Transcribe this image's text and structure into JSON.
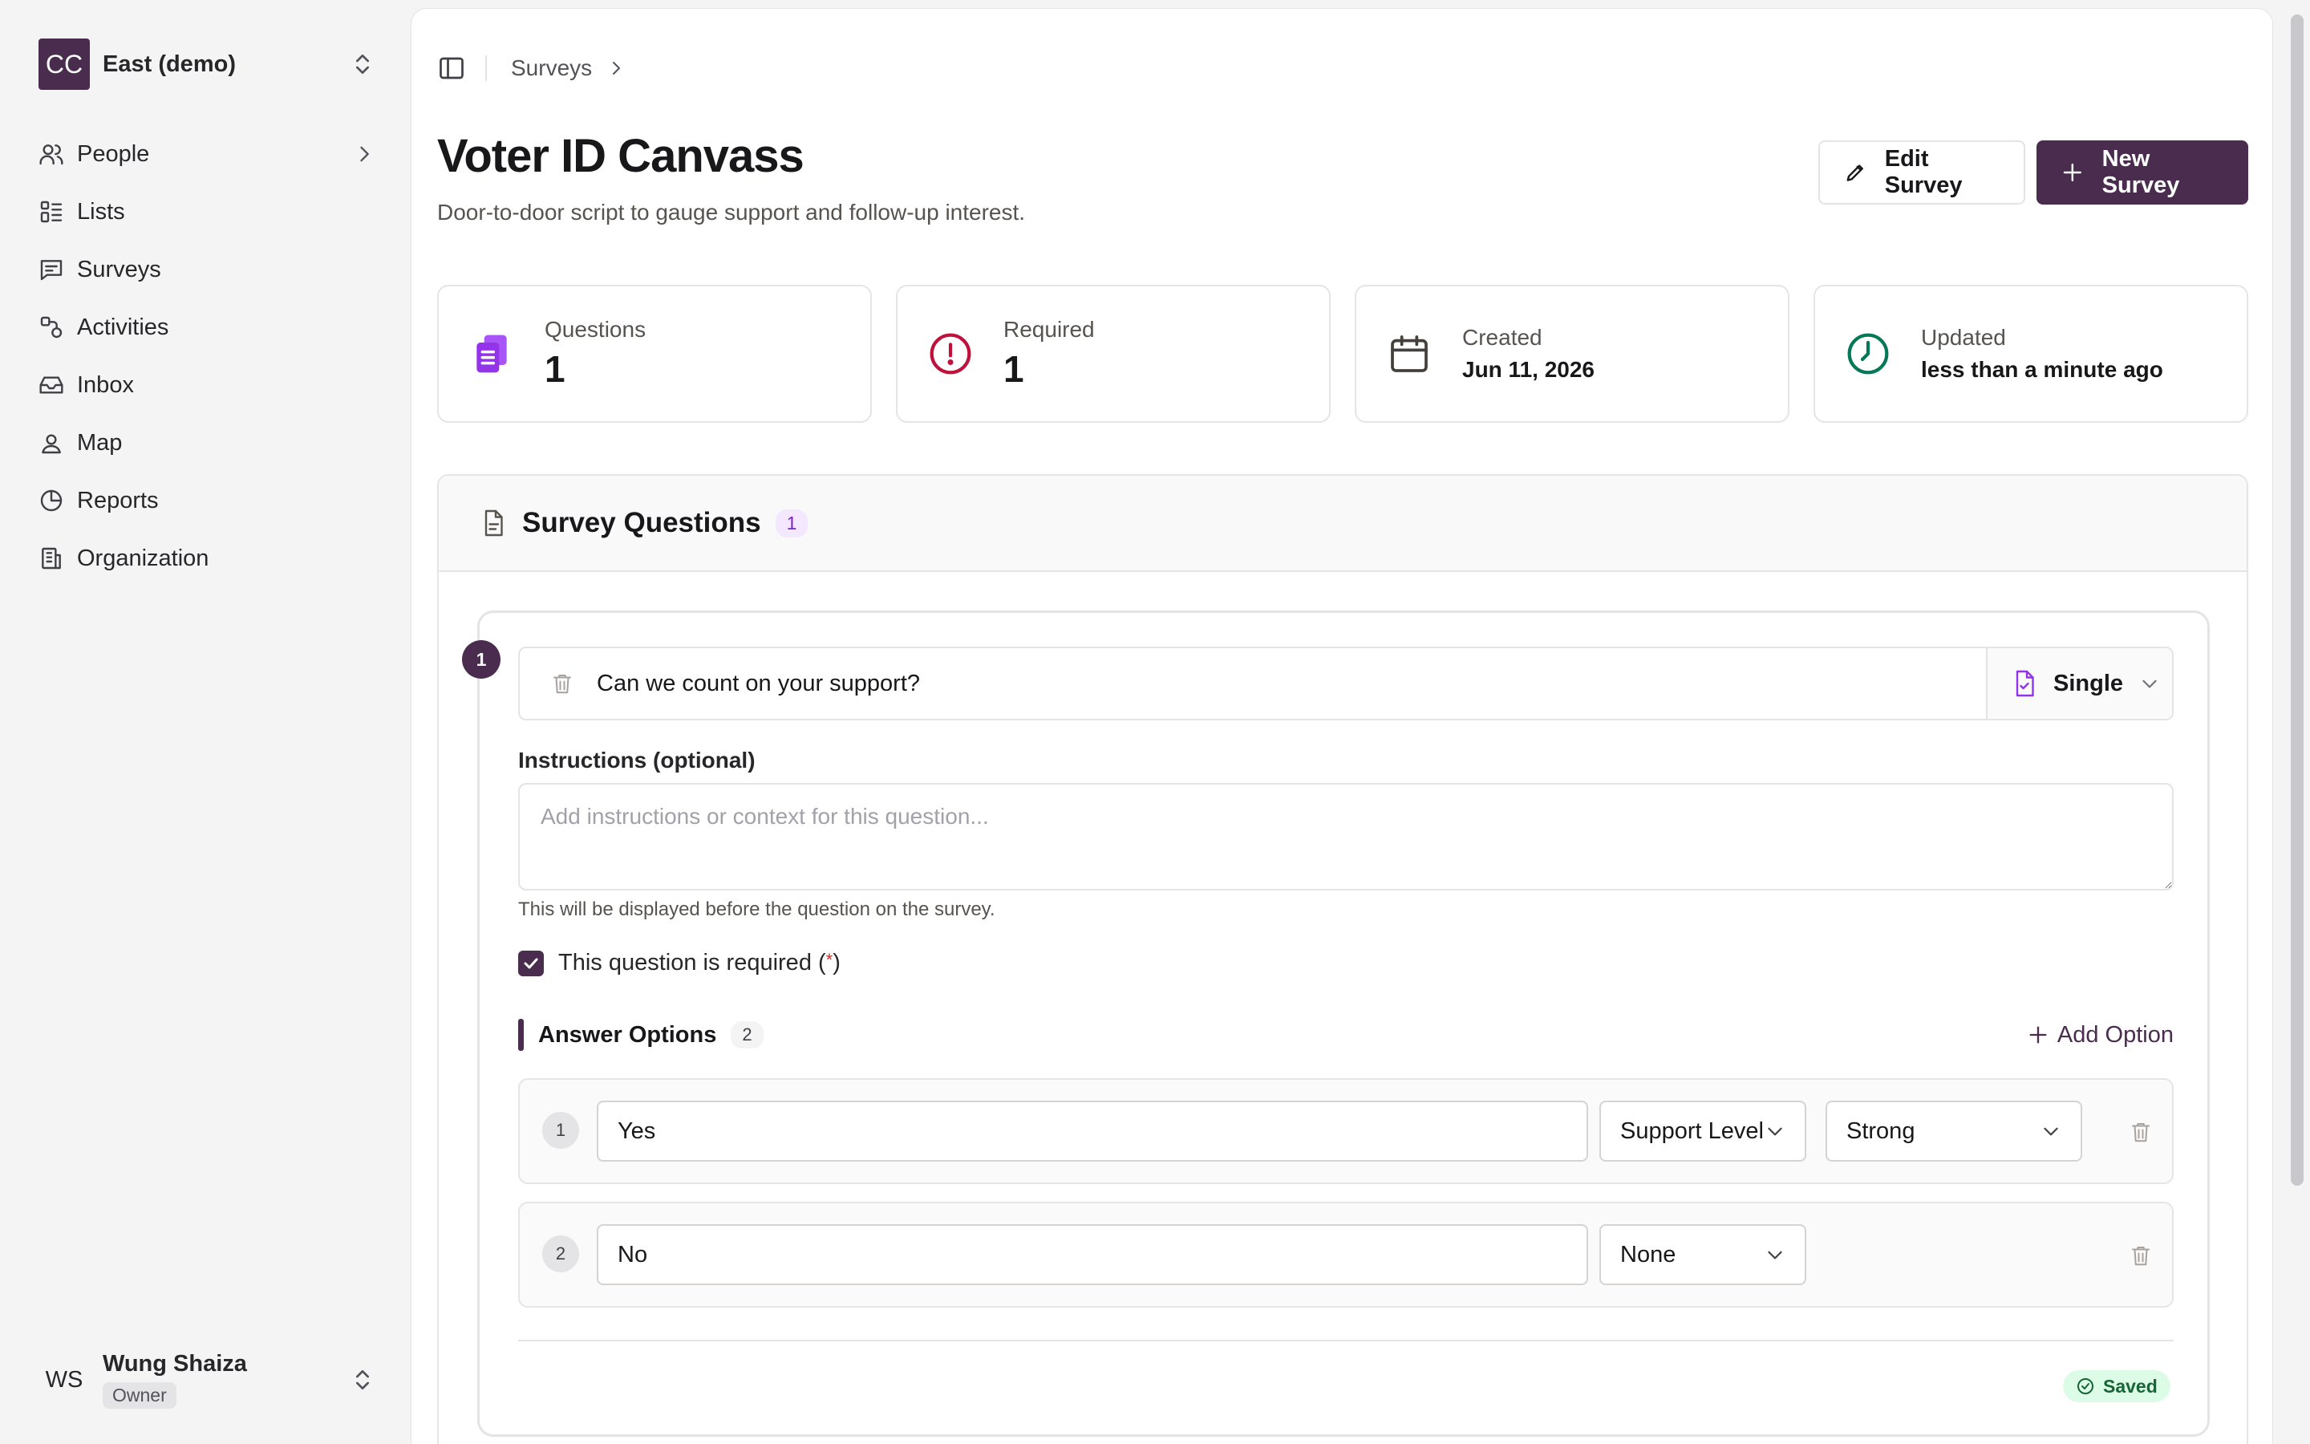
{
  "sidebar": {
    "org": {
      "initials": "CC",
      "name": "East (demo)"
    },
    "items": [
      {
        "label": "People",
        "icon": "users-icon",
        "has_chevron": true
      },
      {
        "label": "Lists",
        "icon": "list-icon"
      },
      {
        "label": "Surveys",
        "icon": "message-square-icon"
      },
      {
        "label": "Activities",
        "icon": "activities-icon"
      },
      {
        "label": "Inbox",
        "icon": "inbox-icon"
      },
      {
        "label": "Map",
        "icon": "map-pin-icon"
      },
      {
        "label": "Reports",
        "icon": "pie-chart-icon"
      },
      {
        "label": "Organization",
        "icon": "building-icon"
      }
    ],
    "user": {
      "initials": "WS",
      "name": "Wung Shaiza",
      "role": "Owner"
    }
  },
  "breadcrumb": {
    "items": [
      "Surveys"
    ]
  },
  "page": {
    "title": "Voter ID Canvass",
    "description": "Door-to-door script to gauge support and follow-up interest.",
    "edit_label": "Edit Survey",
    "new_label": "New Survey"
  },
  "stats": [
    {
      "label": "Questions",
      "value": "1",
      "icon": "clipboard-copy-icon",
      "color": "#9333ea"
    },
    {
      "label": "Required",
      "value": "1",
      "icon": "alert-circle-icon",
      "color": "#be123c"
    },
    {
      "label": "Created",
      "value": "Jun 11, 2026",
      "icon": "calendar-icon",
      "color": "#44403c"
    },
    {
      "label": "Updated",
      "value": "less than a minute ago",
      "icon": "clock-icon",
      "color": "#047857"
    }
  ],
  "survey_questions": {
    "title": "Survey Questions",
    "count": "1",
    "questions": [
      {
        "number": "1",
        "text": "Can we count on your support?",
        "type": "Single",
        "instructions_label": "Instructions (optional)",
        "instructions_value": "",
        "instructions_placeholder": "Add instructions or context for this question...",
        "instructions_hint": "This will be displayed before the question on the survey.",
        "required_label_prefix": "This question is required (",
        "required_star": "*",
        "required_label_suffix": ")",
        "required": true,
        "answer_options_title": "Answer Options",
        "answer_options_count": "2",
        "add_option_label": "Add Option",
        "options": [
          {
            "number": "1",
            "value": "Yes",
            "mapping": "Support Level",
            "level": "Strong"
          },
          {
            "number": "2",
            "value": "No",
            "mapping": "None"
          }
        ],
        "status": "Saved"
      }
    ]
  },
  "colors": {
    "brand": "#4a2c4e",
    "accent_purple": "#9333ea",
    "saved_green": "#166534"
  }
}
